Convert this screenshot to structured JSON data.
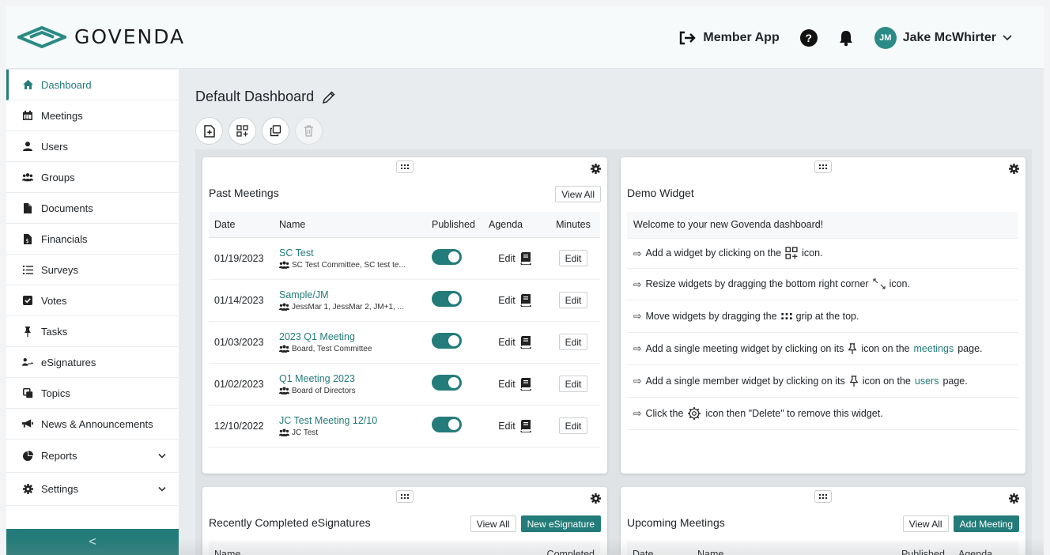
{
  "header": {
    "brand": "GOVENDA",
    "member_app": "Member App",
    "help_glyph": "?",
    "user_initials": "JM",
    "user_name": "Jake McWhirter",
    "colors": {
      "accent": "#237c79",
      "logo_teal": "#2a8a85"
    }
  },
  "sidebar": {
    "items": [
      {
        "label": "Dashboard",
        "icon": "home-icon"
      },
      {
        "label": "Meetings",
        "icon": "calendar-icon"
      },
      {
        "label": "Users",
        "icon": "user-icon"
      },
      {
        "label": "Groups",
        "icon": "users-icon"
      },
      {
        "label": "Documents",
        "icon": "file-icon"
      },
      {
        "label": "Financials",
        "icon": "invoice-icon"
      },
      {
        "label": "Surveys",
        "icon": "list-icon"
      },
      {
        "label": "Votes",
        "icon": "checkbox-icon"
      },
      {
        "label": "Tasks",
        "icon": "pin-icon"
      },
      {
        "label": "eSignatures",
        "icon": "signature-icon"
      },
      {
        "label": "Topics",
        "icon": "topics-icon"
      },
      {
        "label": "News & Announcements",
        "icon": "megaphone-icon"
      },
      {
        "label": "Reports",
        "icon": "pie-chart-icon"
      },
      {
        "label": "Settings",
        "icon": "gear-icon"
      }
    ],
    "collapse_glyph": "<"
  },
  "dashboard": {
    "title": "Default Dashboard"
  },
  "past_meetings": {
    "title": "Past Meetings",
    "view_all": "View All",
    "columns": [
      "Date",
      "Name",
      "Published",
      "Agenda",
      "Minutes"
    ],
    "rows": [
      {
        "date": "01/19/2023",
        "name": "SC Test",
        "groups": "SC Test Committee, SC test te...",
        "agenda": "Edit",
        "minutes": "Edit"
      },
      {
        "date": "01/14/2023",
        "name": "Sample/JM",
        "groups": "JessMar 1, JessMar 2, JM+1, ...",
        "agenda": "Edit",
        "minutes": "Edit"
      },
      {
        "date": "01/03/2023",
        "name": "2023 Q1 Meeting",
        "groups": "Board, Test Committee",
        "agenda": "Edit",
        "minutes": "Edit"
      },
      {
        "date": "01/02/2023",
        "name": "Q1 Meeting 2023",
        "groups": "Board of Directors",
        "agenda": "Edit",
        "minutes": "Edit"
      },
      {
        "date": "12/10/2022",
        "name": "JC Test Meeting 12/10",
        "groups": "JC Test",
        "agenda": "Edit",
        "minutes": "Edit"
      }
    ]
  },
  "demo_widget": {
    "title": "Demo Widget",
    "welcome": "Welcome to your new Govenda dashboard!",
    "arrow": "⇨",
    "line1_a": "Add a widget by clicking on the",
    "line1_b": "icon.",
    "line2_a": "Resize widgets by dragging the bottom right corner",
    "line2_b": "icon.",
    "line3_a": "Move widgets by dragging the",
    "line3_b": "grip at the top.",
    "line4_a": "Add a single meeting widget by clicking on its",
    "line4_b": "icon on the",
    "line4_link": "meetings",
    "line4_c": "page.",
    "line5_a": "Add a single member widget by clicking on its",
    "line5_b": "icon on the",
    "line5_link": "users",
    "line5_c": "page.",
    "line6_a": "Click the",
    "line6_b": "icon then \"Delete\" to remove this widget."
  },
  "esignatures": {
    "title": "Recently Completed eSignatures",
    "view_all": "View All",
    "new_button": "New eSignature",
    "columns": [
      "Name",
      "Completed"
    ]
  },
  "upcoming": {
    "title": "Upcoming Meetings",
    "view_all": "View All",
    "add_button": "Add Meeting",
    "columns": [
      "Date",
      "Name",
      "Published",
      "Agenda"
    ]
  }
}
